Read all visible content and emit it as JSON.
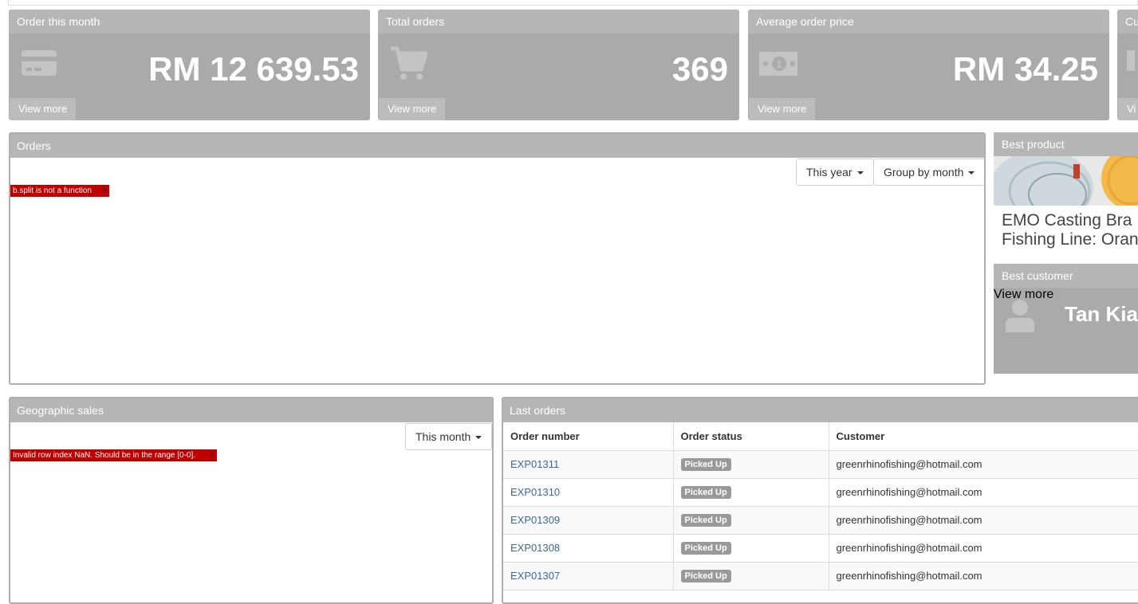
{
  "kpis": [
    {
      "title": "Order this month",
      "value": "RM 12 639.53",
      "more": "View more",
      "icon": "credit-card-icon"
    },
    {
      "title": "Total orders",
      "value": "369",
      "more": "View more",
      "icon": "cart-icon"
    },
    {
      "title": "Average order price",
      "value": "RM 34.25",
      "more": "View more",
      "icon": "money-icon"
    },
    {
      "title": "Cu",
      "value": "",
      "more": "Vi",
      "icon": "cart-icon"
    }
  ],
  "orders_panel": {
    "title": "Orders",
    "period_button": "This year",
    "group_button": "Group by month",
    "error": "b.split is not a function",
    "error_close": "×"
  },
  "best_product": {
    "title": "Best product",
    "name_line1": "EMO Casting Bra",
    "name_line2": "Fishing Line: Oran"
  },
  "best_customer": {
    "title": "Best customer",
    "name": "Tan Kia",
    "more": "View more",
    "icon": "user-icon"
  },
  "geo_panel": {
    "title": "Geographic sales",
    "period_button": "This month",
    "error": "Invalid row index NaN. Should be in the range [0-0].",
    "error_close": "×"
  },
  "last_orders": {
    "title": "Last orders",
    "columns": [
      "Order number",
      "Order status",
      "Customer"
    ],
    "rows": [
      {
        "number": "EXP01311",
        "status": "Picked Up",
        "customer": "greenrhinofishing@hotmail.com"
      },
      {
        "number": "EXP01310",
        "status": "Picked Up",
        "customer": "greenrhinofishing@hotmail.com"
      },
      {
        "number": "EXP01309",
        "status": "Picked Up",
        "customer": "greenrhinofishing@hotmail.com"
      },
      {
        "number": "EXP01308",
        "status": "Picked Up",
        "customer": "greenrhinofishing@hotmail.com"
      },
      {
        "number": "EXP01307",
        "status": "Picked Up",
        "customer": "greenrhinofishing@hotmail.com"
      }
    ]
  },
  "colors": {
    "tile": "#aaaaaa",
    "tile_header": "#b6b6b6",
    "error": "#c00000",
    "link": "#3a6a9a"
  }
}
